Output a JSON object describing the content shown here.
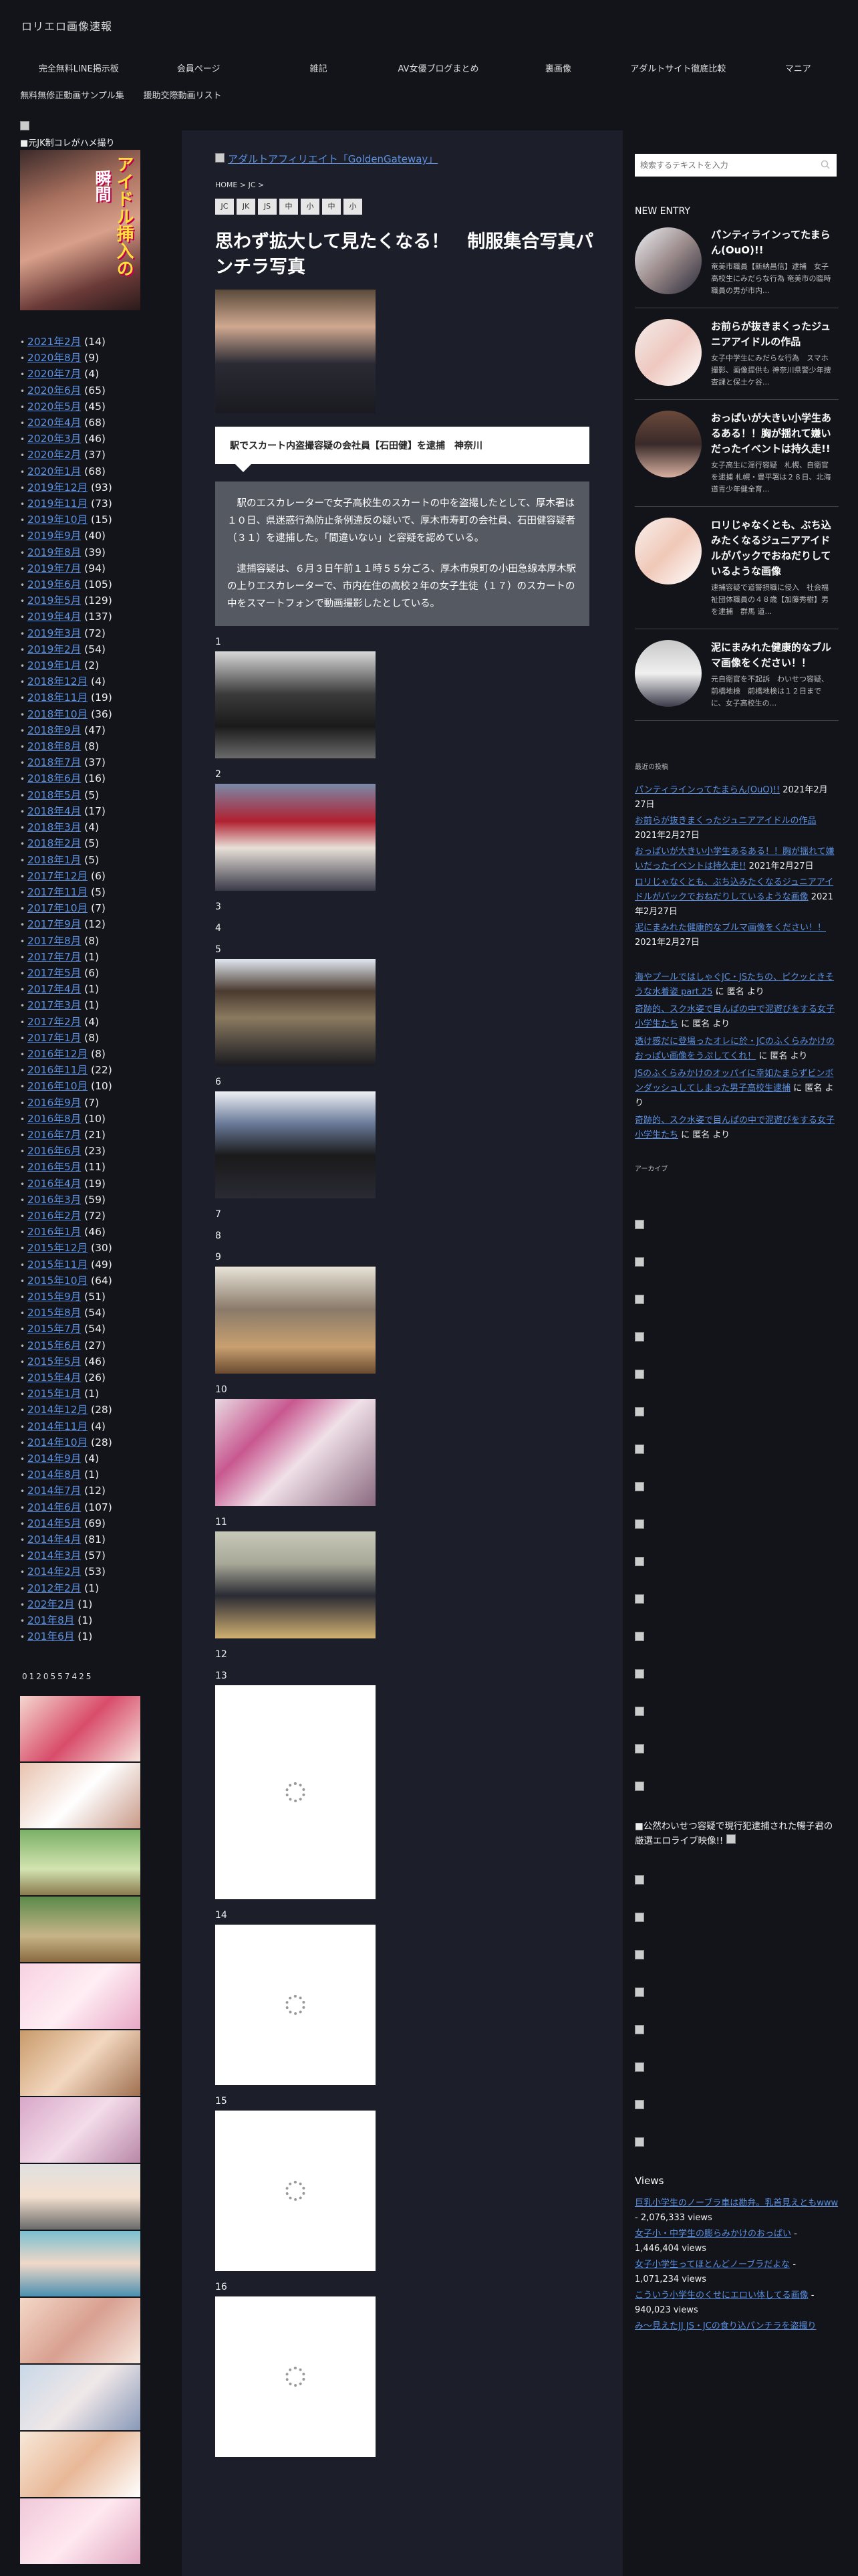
{
  "site": {
    "title": "ロリエロ画像速報",
    "nav_row1": [
      "完全無料LINE掲示板",
      "会員ページ",
      "雑記",
      "AV女優ブログまとめ",
      "裏画像",
      "アダルトサイト徹底比較",
      "マニア"
    ],
    "nav_row2": [
      "無料無修正動画サンプル集",
      "援助交際動画リスト"
    ]
  },
  "left": {
    "banner_caption": "■元JK制コレがハメ撮り",
    "banner_text_1": "アイドル挿入の",
    "banner_text_2": "瞬間",
    "archives": [
      {
        "month": "2021年2月",
        "count": "(14)"
      },
      {
        "month": "2020年8月",
        "count": "(9)"
      },
      {
        "month": "2020年7月",
        "count": "(4)"
      },
      {
        "month": "2020年6月",
        "count": "(65)"
      },
      {
        "month": "2020年5月",
        "count": "(45)"
      },
      {
        "month": "2020年4月",
        "count": "(68)"
      },
      {
        "month": "2020年3月",
        "count": "(46)"
      },
      {
        "month": "2020年2月",
        "count": "(37)"
      },
      {
        "month": "2020年1月",
        "count": "(68)"
      },
      {
        "month": "2019年12月",
        "count": "(93)"
      },
      {
        "month": "2019年11月",
        "count": "(73)"
      },
      {
        "month": "2019年10月",
        "count": "(15)"
      },
      {
        "month": "2019年9月",
        "count": "(40)"
      },
      {
        "month": "2019年8月",
        "count": "(39)"
      },
      {
        "month": "2019年7月",
        "count": "(94)"
      },
      {
        "month": "2019年6月",
        "count": "(105)"
      },
      {
        "month": "2019年5月",
        "count": "(129)"
      },
      {
        "month": "2019年4月",
        "count": "(137)"
      },
      {
        "month": "2019年3月",
        "count": "(72)"
      },
      {
        "month": "2019年2月",
        "count": "(54)"
      },
      {
        "month": "2019年1月",
        "count": "(2)"
      },
      {
        "month": "2018年12月",
        "count": "(4)"
      },
      {
        "month": "2018年11月",
        "count": "(19)"
      },
      {
        "month": "2018年10月",
        "count": "(36)"
      },
      {
        "month": "2018年9月",
        "count": "(47)"
      },
      {
        "month": "2018年8月",
        "count": "(8)"
      },
      {
        "month": "2018年7月",
        "count": "(37)"
      },
      {
        "month": "2018年6月",
        "count": "(16)"
      },
      {
        "month": "2018年5月",
        "count": "(5)"
      },
      {
        "month": "2018年4月",
        "count": "(17)"
      },
      {
        "month": "2018年3月",
        "count": "(4)"
      },
      {
        "month": "2018年2月",
        "count": "(5)"
      },
      {
        "month": "2018年1月",
        "count": "(5)"
      },
      {
        "month": "2017年12月",
        "count": "(6)"
      },
      {
        "month": "2017年11月",
        "count": "(5)"
      },
      {
        "month": "2017年10月",
        "count": "(7)"
      },
      {
        "month": "2017年9月",
        "count": "(12)"
      },
      {
        "month": "2017年8月",
        "count": "(8)"
      },
      {
        "month": "2017年7月",
        "count": "(1)"
      },
      {
        "month": "2017年5月",
        "count": "(6)"
      },
      {
        "month": "2017年4月",
        "count": "(1)"
      },
      {
        "month": "2017年3月",
        "count": "(1)"
      },
      {
        "month": "2017年2月",
        "count": "(4)"
      },
      {
        "month": "2017年1月",
        "count": "(8)"
      },
      {
        "month": "2016年12月",
        "count": "(8)"
      },
      {
        "month": "2016年11月",
        "count": "(22)"
      },
      {
        "month": "2016年10月",
        "count": "(10)"
      },
      {
        "month": "2016年9月",
        "count": "(7)"
      },
      {
        "month": "2016年8月",
        "count": "(10)"
      },
      {
        "month": "2016年7月",
        "count": "(21)"
      },
      {
        "month": "2016年6月",
        "count": "(23)"
      },
      {
        "month": "2016年5月",
        "count": "(11)"
      },
      {
        "month": "2016年4月",
        "count": "(19)"
      },
      {
        "month": "2016年3月",
        "count": "(59)"
      },
      {
        "month": "2016年2月",
        "count": "(72)"
      },
      {
        "month": "2016年1月",
        "count": "(46)"
      },
      {
        "month": "2015年12月",
        "count": "(30)"
      },
      {
        "month": "2015年11月",
        "count": "(49)"
      },
      {
        "month": "2015年10月",
        "count": "(64)"
      },
      {
        "month": "2015年9月",
        "count": "(51)"
      },
      {
        "month": "2015年8月",
        "count": "(54)"
      },
      {
        "month": "2015年7月",
        "count": "(54)"
      },
      {
        "month": "2015年6月",
        "count": "(27)"
      },
      {
        "month": "2015年5月",
        "count": "(46)"
      },
      {
        "month": "2015年4月",
        "count": "(26)"
      },
      {
        "month": "2015年1月",
        "count": "(1)"
      },
      {
        "month": "2014年12月",
        "count": "(28)"
      },
      {
        "month": "2014年11月",
        "count": "(4)"
      },
      {
        "month": "2014年10月",
        "count": "(28)"
      },
      {
        "month": "2014年9月",
        "count": "(4)"
      },
      {
        "month": "2014年8月",
        "count": "(1)"
      },
      {
        "month": "2014年7月",
        "count": "(12)"
      },
      {
        "month": "2014年6月",
        "count": "(107)"
      },
      {
        "month": "2014年5月",
        "count": "(69)"
      },
      {
        "month": "2014年4月",
        "count": "(81)"
      },
      {
        "month": "2014年3月",
        "count": "(57)"
      },
      {
        "month": "2014年2月",
        "count": "(53)"
      },
      {
        "month": "2012年2月",
        "count": "(1)"
      },
      {
        "month": "202年2月",
        "count": "(1)"
      },
      {
        "month": "201年8月",
        "count": "(1)"
      },
      {
        "month": "201年6月",
        "count": "(1)"
      }
    ],
    "counter": "0120557425"
  },
  "main": {
    "top_banner": "アダルトアフィリエイト「GoldenGateway」",
    "breadcrumb": "HOME > JC >",
    "tags": [
      "JC",
      "JK",
      "JS",
      "中",
      "小",
      "中",
      "小"
    ],
    "title": "思わず拡大して見たくなる！　制服集合写真パンチラ写真",
    "info": "駅でスカート内盗撮容疑の会社員【石田健】を逮捕　神奈川",
    "quote_p1": "駅のエスカレーターで女子高校生のスカートの中を盗撮したとして、厚木署は１０日、県迷惑行為防止条例違反の疑いで、厚木市寿町の会社員、石田健容疑者（３１）を逮捕した。「間違いない」と容疑を認めている。",
    "quote_p2": "逮捕容疑は、６月３日午前１１時５５分ごろ、厚木市泉町の小田急線本厚木駅の上りエスカレーターで、市内在住の高校２年の女子生徒（１７）のスカートの中をスマートフォンで動画撮影したとしている。",
    "labels": [
      "1",
      "2",
      "3",
      "4",
      "5",
      "6",
      "7",
      "8",
      "9",
      "10",
      "11",
      "12",
      "13",
      "14",
      "15",
      "16"
    ]
  },
  "right": {
    "search_placeholder": "検索するテキストを入力",
    "new_entry_title": "NEW ENTRY",
    "entries": [
      {
        "title": "パンティラインってたまらん(OuO)!!",
        "excerpt": "奄美市職員【新納昌信】逮捕　女子高校生にみだらな行為 奄美市の臨時職員の男が市内..."
      },
      {
        "title": "お前らが抜きまくったジュニアアイドルの作品",
        "excerpt": "女子中学生にみだらな行為　スマホ撮影、画像提供も 神奈川県警少年捜査課と保土ケ谷..."
      },
      {
        "title": "おっぱいが大きい小学生あるある！！胸が揺れて嫌いだったイベントは持久走!!",
        "excerpt": "女子高生に淫行容疑　札幌、自衛官を逮捕 札幌・豊平署は２８日、北海道青少年健全育..."
      },
      {
        "title": "ロリじゃなくとも、ぶち込みたくなるジュニアアイドルがパックでおねだりしているような画像",
        "excerpt": "速捕容疑で道警摂職に侵入　社会福祉団体職員の４８歳【加藤秀樹】男を逮捕　群馬 道..."
      },
      {
        "title": "泥にまみれた健康的なブルマ画像をください！！",
        "excerpt": "元自衛官を不起訴　わいせつ容疑、前橋地検　前橋地検は１２日までに、女子高校生の..."
      }
    ],
    "recent_posts_title": "最近の投稿",
    "recent_posts": [
      {
        "link": "パンティラインってたまらん(OuO)!!",
        "date": "2021年2月27日"
      },
      {
        "link": "お前らが抜きまくったジュニアアイドルの作品",
        "date": "2021年2月27日"
      },
      {
        "link": "おっぱいが大きい小学生あるある！！胸が揺れて嫌いだったイベントは持久走!!",
        "date": "2021年2月27日"
      },
      {
        "link": "ロリじゃなくとも、ぶち込みたくなるジュニアアイドルがパックでおねだりしているような画像",
        "date": "2021年2月27日"
      },
      {
        "link": "泥にまみれた健康的なブルマ画像をください！！",
        "date": "2021年2月27日"
      }
    ],
    "recent_comments": [
      {
        "link": "海やプールではしゃぐJC・JSたちの、ピクッときそうな水着姿 part.25",
        "by": "に 匿名 より"
      },
      {
        "link": "奇跡的、スク水姿で目んぱの中で泥遊びをする女子小学生たち",
        "by": "に 匿名 より"
      },
      {
        "link": "透け感だに登場ったオレに於・JCのふくらみかけのおっぱい画像をうぷしてくれ！",
        "by": "に 匿名 より"
      },
      {
        "link": "JSのふくらみかけのオッパイに幸如たまらずビンボンダッシュしてしまった男子高校生逮捕",
        "by": "に 匿名 より"
      },
      {
        "link": "奇跡的、スク水姿で目んぱの中で泥遊びをする女子小学生たち",
        "by": "に 匿名 より"
      }
    ],
    "archive_small_title": "アーカイブ",
    "public_note": "■公然わいせつ容疑で現行犯逮捕された暢子君の厳選エロライブ映像!!",
    "views_title": "Views",
    "views": [
      {
        "link": "巨乳小学生のノーブラ車は勘弁。乳首見えともwww",
        "count": " - 2,076,333 views"
      },
      {
        "link": "女子小・中学生の膨らみかけのおっぱい",
        "count": " - 1,446,404 views"
      },
      {
        "link": "女子小学生ってほとんどノーブラだよな",
        "count": " - 1,071,234 views"
      },
      {
        "link": "こういう小学生のくせにエロい体してる画像",
        "count": " - 940,023 views"
      },
      {
        "link": "み～見えたJJ JS・JCの食り込パンチラを盗撮り",
        "count": ""
      }
    ]
  }
}
